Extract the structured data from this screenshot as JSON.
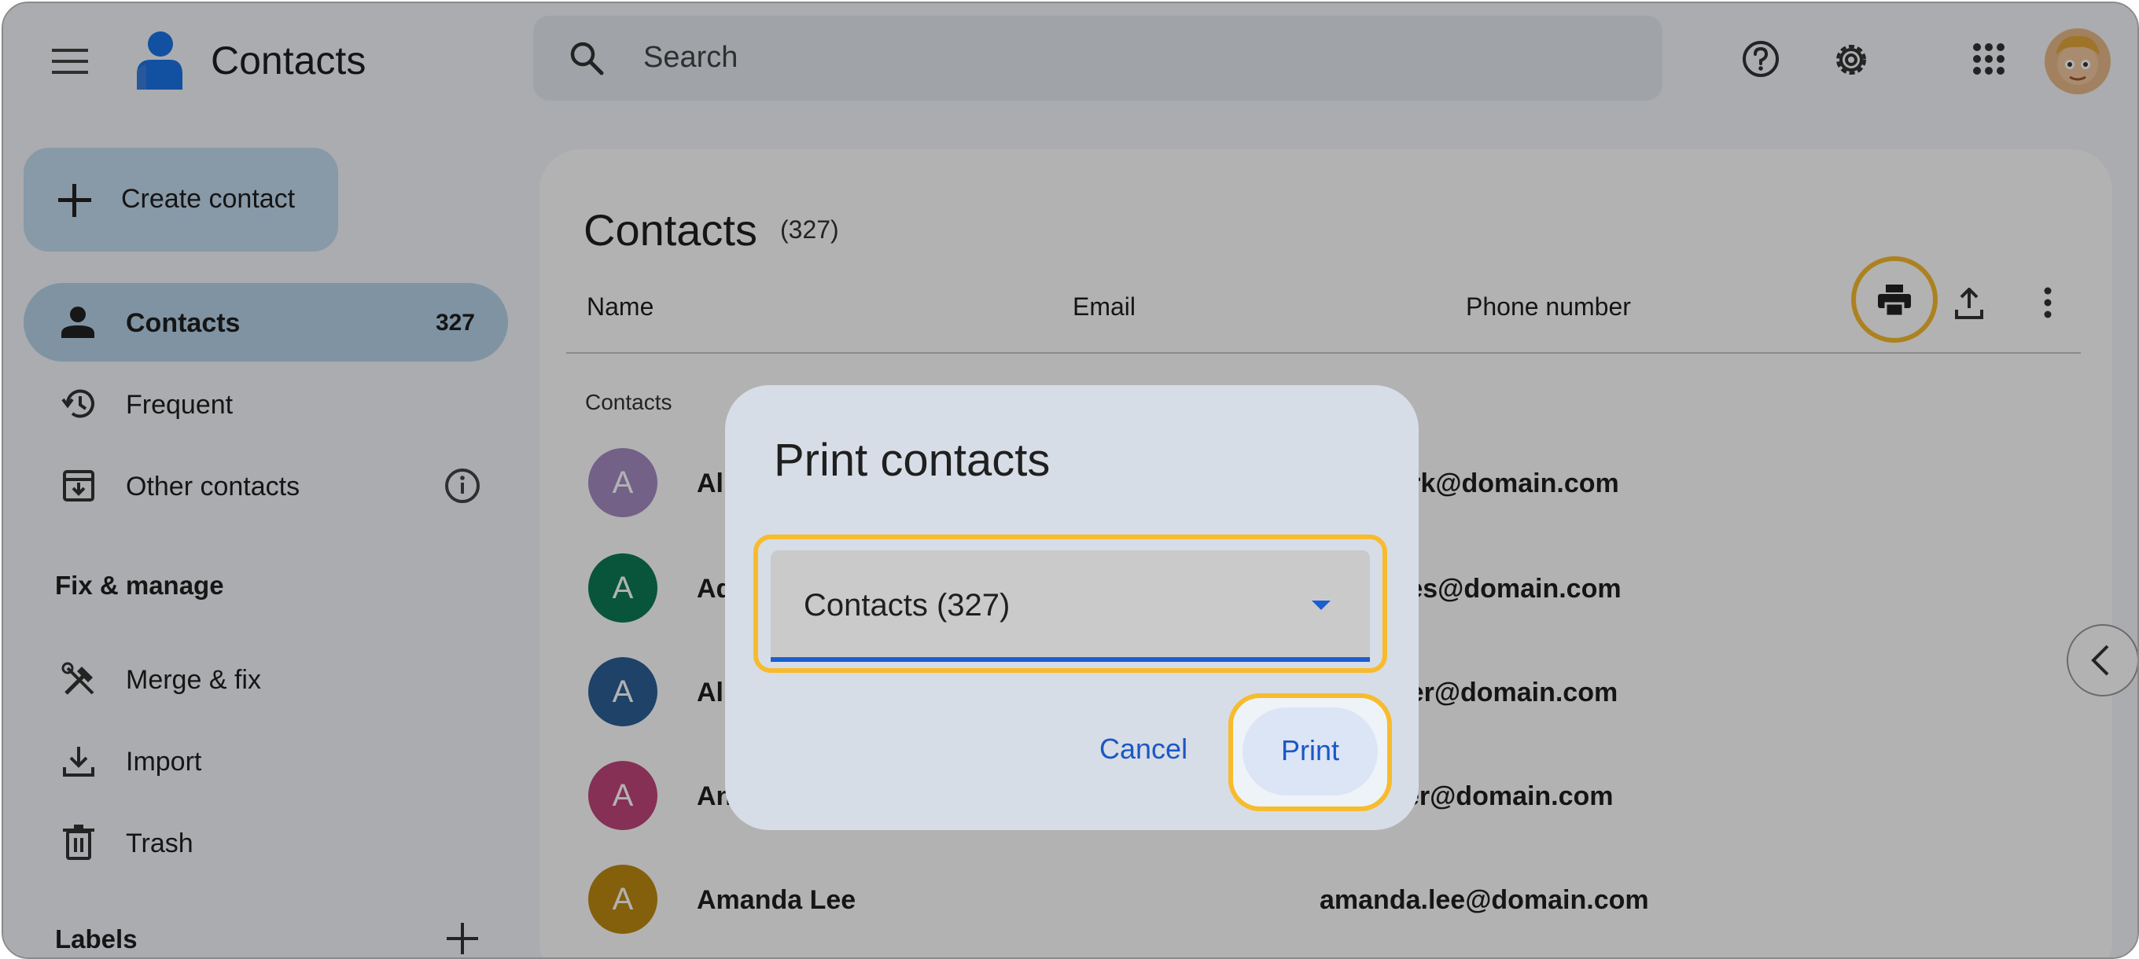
{
  "app": {
    "title": "Contacts"
  },
  "search": {
    "placeholder": "Search"
  },
  "sidebar": {
    "create_label": "Create contact",
    "items": [
      {
        "label": "Contacts",
        "count": "327",
        "icon": "person-icon",
        "active": true
      },
      {
        "label": "Frequent",
        "icon": "history-icon"
      },
      {
        "label": "Other contacts",
        "icon": "archive-download-icon"
      }
    ],
    "fix_manage_heading": "Fix & manage",
    "fix_items": [
      {
        "label": "Merge & fix",
        "icon": "tools-icon"
      },
      {
        "label": "Import",
        "icon": "download-icon"
      },
      {
        "label": "Trash",
        "icon": "trash-icon"
      }
    ],
    "labels_heading": "Labels"
  },
  "main": {
    "title": "Contacts",
    "count": "(327)",
    "columns": {
      "name": "Name",
      "email": "Email",
      "phone": "Phone number"
    },
    "group_label": "Contacts",
    "rows": [
      {
        "initial": "A",
        "name": "Al",
        "email": "work@domain.com",
        "color": "#a58bc3"
      },
      {
        "initial": "A",
        "name": "Ad",
        "email": "ales@domain.com",
        "color": "#0c7a57"
      },
      {
        "initial": "A",
        "name": "Al",
        "email": "ager@domain.com",
        "color": "#2c5f95"
      },
      {
        "initial": "A",
        "name": "An",
        "email": "riter@domain.com",
        "color": "#c1457c"
      },
      {
        "initial": "A",
        "name": "Amanda Lee",
        "email": "amanda.lee@domain.com",
        "color": "#bd8a12"
      }
    ]
  },
  "dialog": {
    "title": "Print contacts",
    "select_value": "Contacts (327)",
    "cancel_label": "Cancel",
    "print_label": "Print"
  },
  "colors": {
    "accent": "#1a5fd1",
    "highlight": "#f7bb2e"
  }
}
